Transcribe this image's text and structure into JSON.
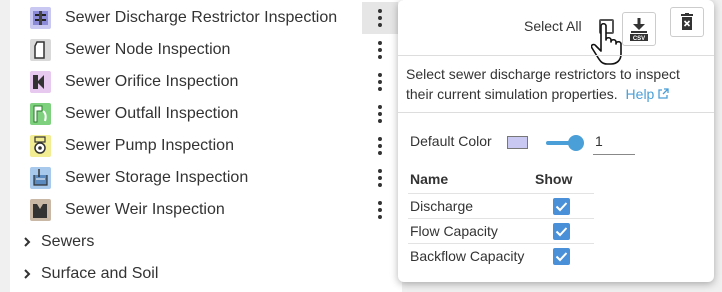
{
  "layers": [
    {
      "label": "Sewer Discharge Restrictor Inspection",
      "icon": "discharge-restrictor-icon",
      "color": "#c8c8f2",
      "kebab_active": true
    },
    {
      "label": "Sewer Node Inspection",
      "icon": "node-icon",
      "color": "#d9d9d9",
      "kebab_active": false
    },
    {
      "label": "Sewer Orifice Inspection",
      "icon": "orifice-icon",
      "color": "#e7c8ef",
      "kebab_active": false
    },
    {
      "label": "Sewer Outfall Inspection",
      "icon": "outfall-icon",
      "color": "#7ed07e",
      "kebab_active": false
    },
    {
      "label": "Sewer Pump Inspection",
      "icon": "pump-icon",
      "color": "#f2ec92",
      "kebab_active": false
    },
    {
      "label": "Sewer Storage Inspection",
      "icon": "storage-icon",
      "color": "#a8c8ec",
      "kebab_active": false
    },
    {
      "label": "Sewer Weir Inspection",
      "icon": "weir-icon",
      "color": "#c9b8a6",
      "kebab_active": false
    }
  ],
  "groups": [
    {
      "label": "Sewers"
    },
    {
      "label": "Surface and Soil"
    }
  ],
  "popup": {
    "select_all_label": "Select All",
    "select_all_checked": false,
    "export_button_icon": "csv-download-icon",
    "delete_button_icon": "delete-icon",
    "description": "Select sewer discharge restrictors to inspect their current simulation properties.",
    "help_label": "Help",
    "default_color_label": "Default Color",
    "default_color": "#c8c8f2",
    "opacity_value": "1",
    "opacity_fraction": 1.0,
    "table": {
      "col_name": "Name",
      "col_show": "Show",
      "rows": [
        {
          "name": "Discharge",
          "show": true
        },
        {
          "name": "Flow Capacity",
          "show": true
        },
        {
          "name": "Backflow Capacity",
          "show": true
        }
      ]
    }
  },
  "accent_color": "#4a9fd8"
}
